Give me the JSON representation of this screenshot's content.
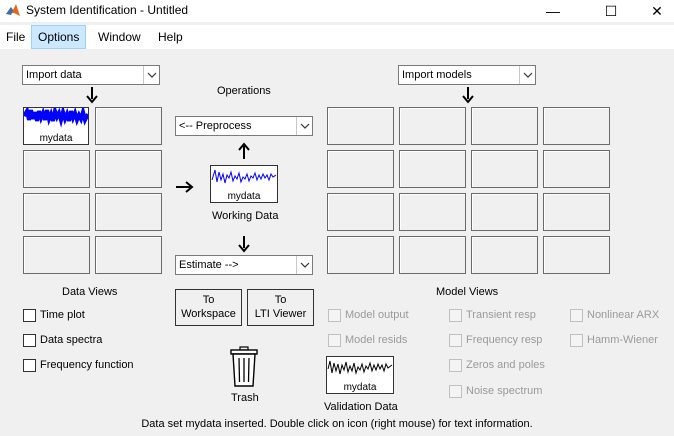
{
  "window": {
    "title": "System Identification - Untitled",
    "min_glyph": "—",
    "max_glyph": "☐",
    "close_glyph": "✕"
  },
  "menu": {
    "items": [
      "File",
      "Options",
      "Window",
      "Help"
    ],
    "active": "Options"
  },
  "import_data": {
    "selected": "Import data"
  },
  "import_models": {
    "selected": "Import models"
  },
  "operations": {
    "title": "Operations",
    "preprocess": "<-- Preprocess",
    "estimate": "Estimate -->",
    "working_data_label": "Working Data",
    "working_data_name": "mydata"
  },
  "data_board": {
    "first_item_name": "mydata"
  },
  "data_views": {
    "title": "Data Views",
    "items": [
      "Time plot",
      "Data spectra",
      "Frequency function"
    ]
  },
  "buttons": {
    "to_workspace": [
      "To",
      "Workspace"
    ],
    "to_lti_viewer": [
      "To",
      "LTI Viewer"
    ]
  },
  "trash": {
    "label": "Trash"
  },
  "validation": {
    "label": "Validation Data",
    "name": "mydata"
  },
  "model_views": {
    "title": "Model Views",
    "col1": [
      "Model output",
      "Model resids"
    ],
    "col2": [
      "Transient resp",
      "Frequency resp",
      "Zeros and poles",
      "Noise spectrum"
    ],
    "col3": [
      "Nonlinear ARX",
      "Hamm-Wiener"
    ]
  },
  "status": "Data set mydata inserted.  Double click on icon (right mouse) for text information.",
  "colors": {
    "signal_blue": "#0000ff",
    "signal_black": "#000000",
    "menu_active_bg": "#cce8ff",
    "disabled_text": "#9a9a9a"
  }
}
